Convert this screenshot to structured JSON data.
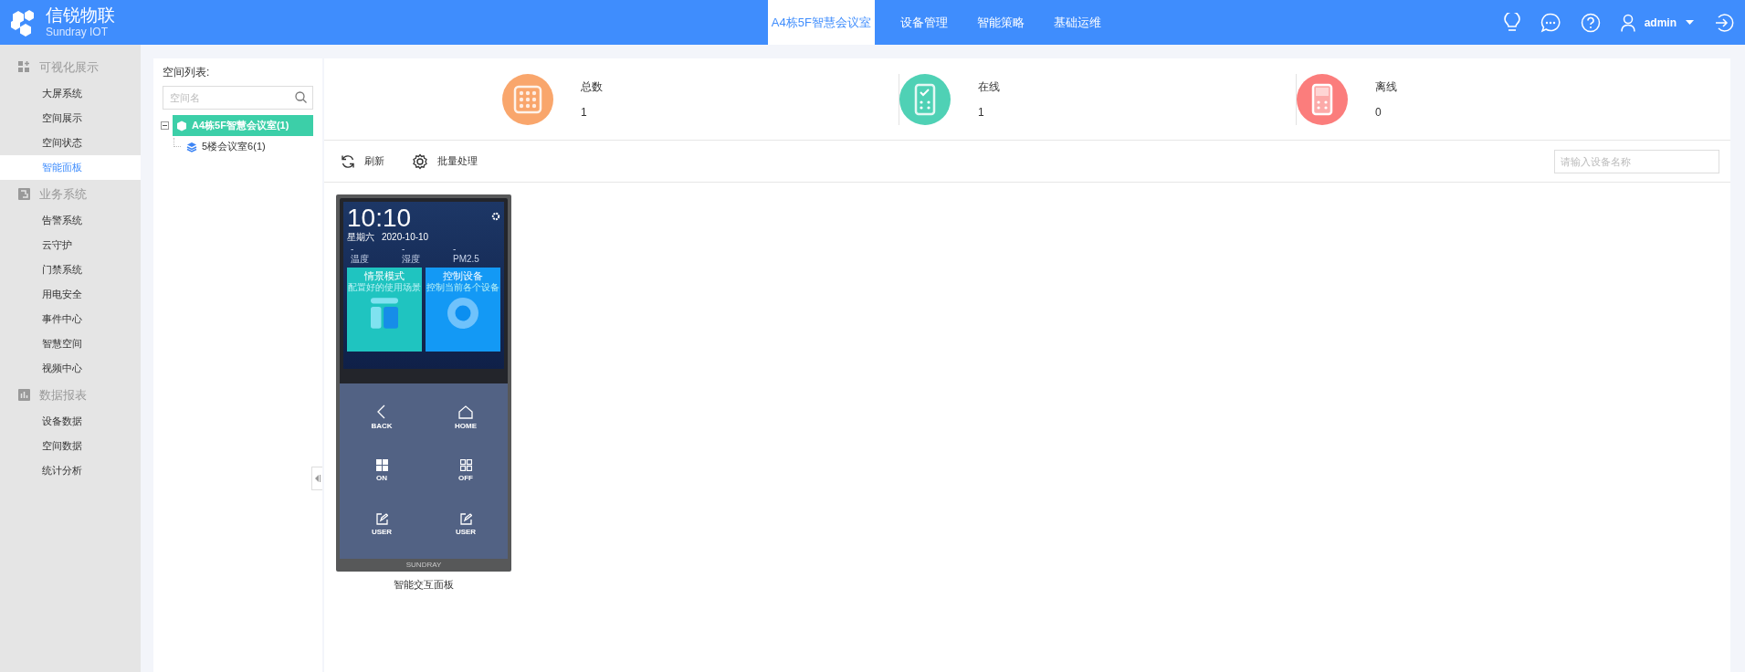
{
  "header": {
    "logo_title": "信锐物联",
    "logo_subtitle": "Sundray IOT",
    "nav": [
      {
        "label": "A4栋5F智慧会议室",
        "selected": true
      },
      {
        "label": "设备管理",
        "selected": false
      },
      {
        "label": "智能策略",
        "selected": false
      },
      {
        "label": "基础运维",
        "selected": false
      }
    ],
    "user": "admin"
  },
  "sidebar": {
    "groups": [
      {
        "kind": "grid",
        "title": "可视化展示",
        "items": [
          {
            "label": "大屏系统",
            "selected": false
          },
          {
            "label": "空间展示",
            "selected": false
          },
          {
            "label": "空间状态",
            "selected": false
          },
          {
            "label": "智能面板",
            "selected": true
          }
        ]
      },
      {
        "kind": "business",
        "title": "业务系统",
        "items": [
          {
            "label": "告警系统",
            "selected": false
          },
          {
            "label": "云守护",
            "selected": false
          },
          {
            "label": "门禁系统",
            "selected": false
          },
          {
            "label": "用电安全",
            "selected": false
          },
          {
            "label": "事件中心",
            "selected": false
          },
          {
            "label": "智慧空间",
            "selected": false
          },
          {
            "label": "视频中心",
            "selected": false
          }
        ]
      },
      {
        "kind": "chart",
        "title": "数据报表",
        "items": [
          {
            "label": "设备数据",
            "selected": false
          },
          {
            "label": "空间数据",
            "selected": false
          },
          {
            "label": "统计分析",
            "selected": false
          }
        ]
      }
    ]
  },
  "space_list": {
    "title": "空间列表:",
    "search_placeholder": "空间名",
    "tree": [
      {
        "label": "A4栋5F智慧会议室(1)",
        "selected": true,
        "expanded": true,
        "children": [
          {
            "label": "5楼会议室6(1)",
            "selected": false
          }
        ]
      }
    ]
  },
  "stats": [
    {
      "kind": "total",
      "label": "总数",
      "value": "1",
      "color": "#f9a66c"
    },
    {
      "kind": "online",
      "label": "在线",
      "value": "1",
      "color": "#4fd1b5"
    },
    {
      "kind": "offline",
      "label": "离线",
      "value": "0",
      "color": "#fb7d7c"
    }
  ],
  "toolbar": {
    "buttons": [
      {
        "kind": "refresh",
        "label": "刷新"
      },
      {
        "kind": "batch",
        "label": "批量处理"
      }
    ],
    "search_placeholder": "请输入设备名称"
  },
  "devices": [
    {
      "name": "智能交互面板",
      "brand": "SUNDRAY",
      "screen": {
        "time": "10:10",
        "weekday": "星期六",
        "date": "2020-10-10",
        "readings": [
          {
            "value": "-",
            "label": "温度"
          },
          {
            "value": "-",
            "label": "湿度"
          },
          {
            "value": "-",
            "label": "PM2.5"
          }
        ],
        "tiles": [
          {
            "kind": "scene",
            "title": "情景模式",
            "subtitle": "配置好的使用场景"
          },
          {
            "kind": "control",
            "title": "控制设备",
            "subtitle": "控制当前各个设备"
          }
        ]
      },
      "buttons": [
        {
          "kind": "back",
          "label": "BACK"
        },
        {
          "kind": "home",
          "label": "HOME"
        },
        {
          "kind": "on",
          "label": "ON"
        },
        {
          "kind": "off",
          "label": "OFF"
        },
        {
          "kind": "user",
          "label": "USER"
        },
        {
          "kind": "user",
          "label": "USER"
        }
      ]
    }
  ]
}
